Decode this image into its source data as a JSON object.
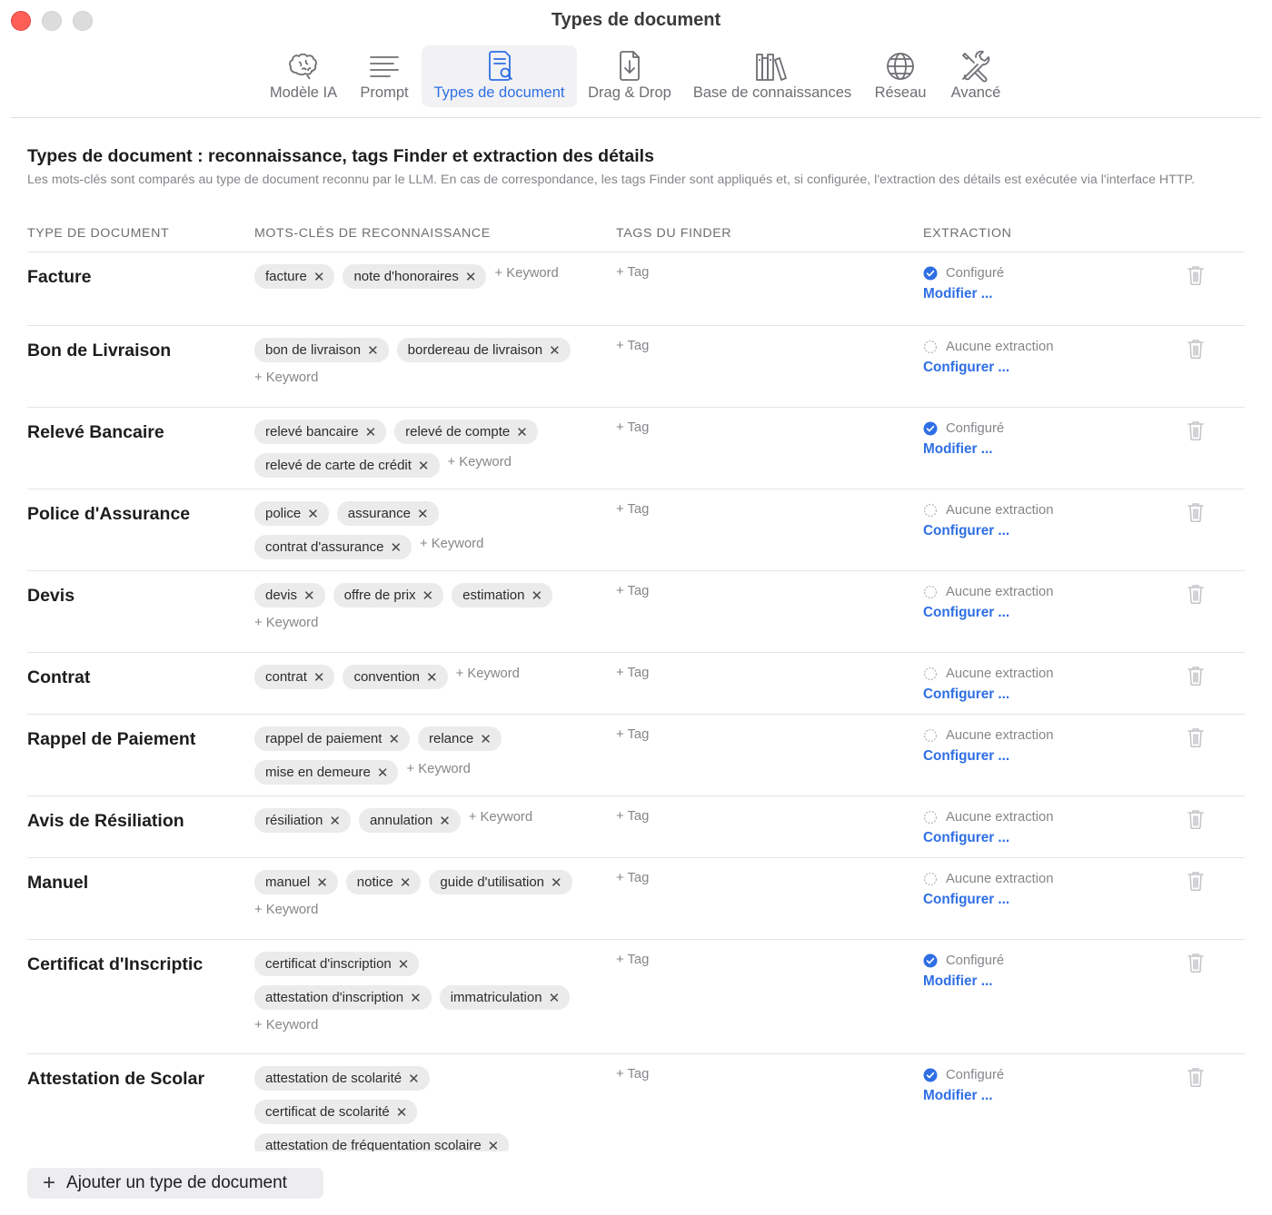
{
  "window": {
    "title": "Types de document"
  },
  "toolbar": {
    "items": [
      {
        "label": "Modèle IA",
        "icon": "brain-icon"
      },
      {
        "label": "Prompt",
        "icon": "lines-icon"
      },
      {
        "label": "Types de document",
        "icon": "document-search-icon",
        "active": true
      },
      {
        "label": "Drag & Drop",
        "icon": "document-download-icon"
      },
      {
        "label": "Base de connaissances",
        "icon": "books-icon"
      },
      {
        "label": "Réseau",
        "icon": "globe-icon"
      },
      {
        "label": "Avancé",
        "icon": "tools-icon"
      }
    ]
  },
  "section": {
    "title": "Types de document : reconnaissance, tags Finder et extraction des détails",
    "description": "Les mots-clés sont comparés au type de document reconnu par le LLM. En cas de correspondance, les tags Finder sont appliqués et, si configurée, l'extraction des détails est exécutée via l'interface HTTP."
  },
  "columns": {
    "type": "TYPE DE DOCUMENT",
    "keywords": "MOTS-CLÉS DE RECONNAISSANCE",
    "tags": "TAGS DU FINDER",
    "extraction": "EXTRACTION"
  },
  "labels": {
    "add_keyword": "+ Keyword",
    "add_tag": "+ Tag",
    "status_configured": "Configuré",
    "status_none": "Aucune extraction",
    "action_modify": "Modifier ...",
    "action_configure": "Configurer ...",
    "chip_remove": "✕"
  },
  "rows": [
    {
      "name": "Facture",
      "keywords": [
        "facture",
        "note d'honoraires"
      ],
      "configured": true
    },
    {
      "name": "Bon de Livraison",
      "keywords": [
        "bon de livraison",
        "bordereau de livraison"
      ],
      "configured": false
    },
    {
      "name": "Relevé Bancaire",
      "keywords": [
        "relevé bancaire",
        "relevé de compte",
        "relevé de carte de crédit"
      ],
      "configured": true
    },
    {
      "name": "Police d'Assurance",
      "keywords": [
        "police",
        "assurance",
        "contrat d'assurance"
      ],
      "configured": false
    },
    {
      "name": "Devis",
      "keywords": [
        "devis",
        "offre de prix",
        "estimation"
      ],
      "configured": false
    },
    {
      "name": "Contrat",
      "keywords": [
        "contrat",
        "convention"
      ],
      "configured": false
    },
    {
      "name": "Rappel de Paiement",
      "keywords": [
        "rappel de paiement",
        "relance",
        "mise en demeure"
      ],
      "configured": false
    },
    {
      "name": "Avis de Résiliation",
      "keywords": [
        "résiliation",
        "annulation"
      ],
      "configured": false
    },
    {
      "name": "Manuel",
      "keywords": [
        "manuel",
        "notice",
        "guide d'utilisation"
      ],
      "configured": false
    },
    {
      "name": "Certificat d'Inscriptic",
      "keywords": [
        "certificat d'inscription",
        "attestation d'inscription",
        "immatriculation"
      ],
      "configured": true
    },
    {
      "name": "Attestation de Scolar",
      "keywords": [
        "attestation de scolarité",
        "certificat de scolarité",
        "attestation de fréquentation scolaire"
      ],
      "configured": true
    }
  ],
  "footer": {
    "add_button": "Ajouter un type de document"
  },
  "colors": {
    "accent": "#2f6fe4",
    "close": "#ff5f57",
    "chip": "#ebebec"
  }
}
